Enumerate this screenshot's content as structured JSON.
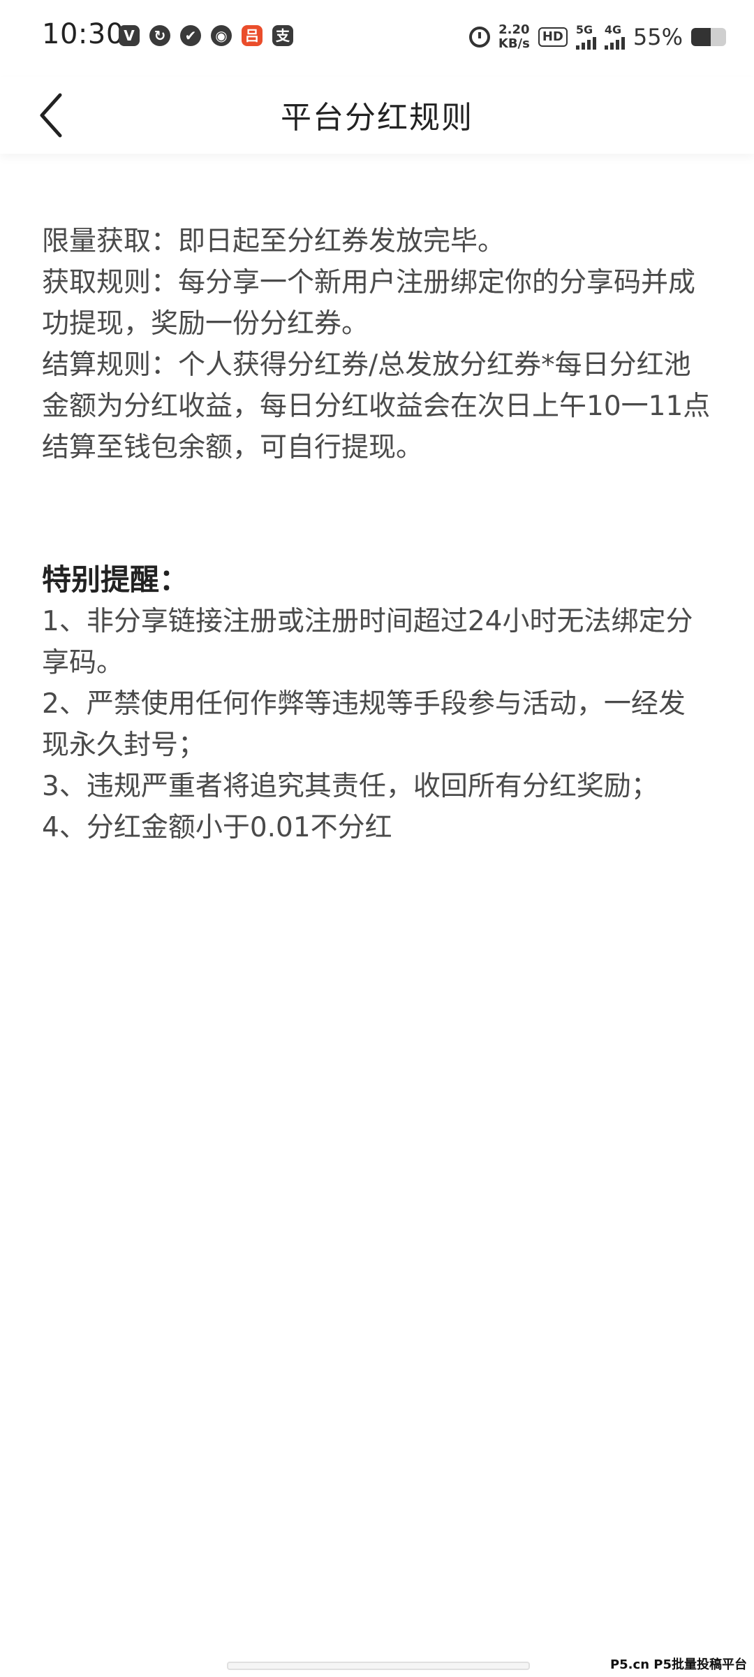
{
  "status_bar": {
    "time": "10:30",
    "app_icons": [
      {
        "name": "v-app-icon",
        "glyph": "V"
      },
      {
        "name": "sync-app-icon",
        "glyph": "↻"
      },
      {
        "name": "shield-app-icon",
        "glyph": "✔"
      },
      {
        "name": "qq-app-icon",
        "glyph": "◉"
      },
      {
        "name": "orange-app-icon",
        "glyph": "吕"
      },
      {
        "name": "alipay-app-icon",
        "glyph": "支"
      }
    ],
    "net_speed_value": "2.20",
    "net_speed_unit": "KB/s",
    "hd_label": "HD",
    "signal_1_label": "5G",
    "signal_2_label": "4G",
    "battery_percent": "55%",
    "battery_level": 0.55,
    "battery_color": "#333333"
  },
  "nav": {
    "back_icon": "chevron-left-icon",
    "title": "平台分红规则"
  },
  "rules": [
    "限量获取：即日起至分红券发放完毕。",
    "获取规则：每分享一个新用户注册绑定你的分享码并成功提现，奖励一份分红券。",
    "结算规则：个人获得分红券/总发放分红券*每日分红池金额为分红收益，每日分红收益会在次日上午10一11点结算至钱包余额，可自行提现。"
  ],
  "reminder": {
    "title": "特别提醒：",
    "items": [
      "1、非分享链接注册或注册时间超过24小时无法绑定分享码。",
      "2、严禁使用任何作弊等违规等手段参与活动，一经发现永久封号；",
      "3、违规严重者将追究其责任，收回所有分红奖励；",
      "4、分红金额小于0.01不分红"
    ]
  },
  "watermark": "P5.cn P5批量投稿平台",
  "colors": {
    "body_text": "#4a4a4a",
    "title_text": "#222222",
    "background": "#ffffff"
  }
}
